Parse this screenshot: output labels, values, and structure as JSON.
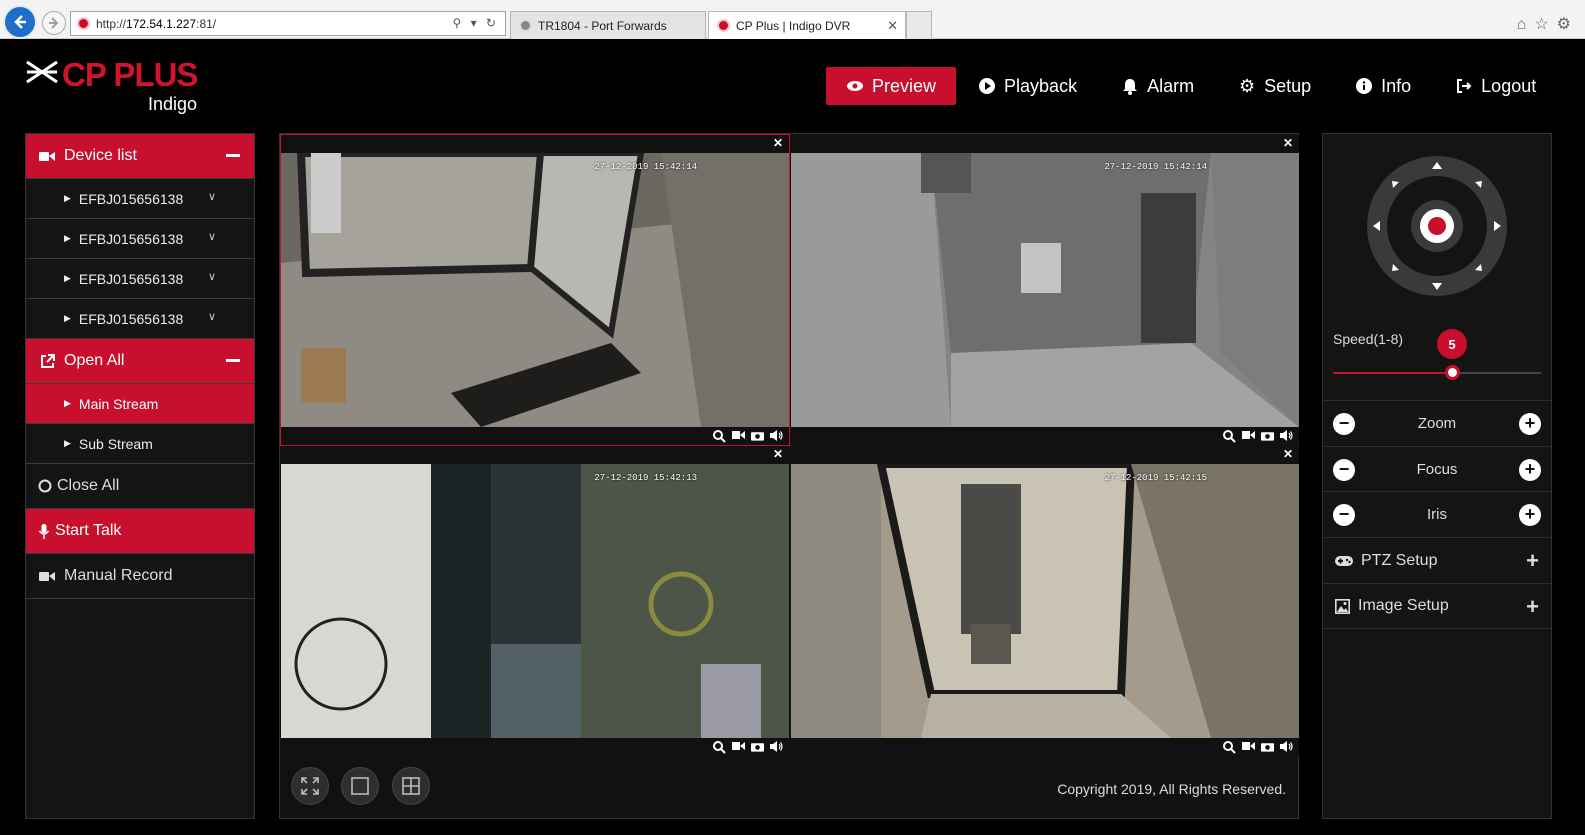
{
  "browser": {
    "url_prefix": "http://",
    "url_host": "172.54.1.227",
    "url_suffix": ":81/",
    "tabs": [
      {
        "title": "TR1804 - Port Forwards"
      },
      {
        "title": "CP Plus | Indigo DVR"
      }
    ]
  },
  "header": {
    "brand": "CP PLUS",
    "subbrand": "Indigo",
    "nav": [
      {
        "label": "Preview",
        "icon": "eye-icon",
        "active": true
      },
      {
        "label": "Playback",
        "icon": "play-circle-icon"
      },
      {
        "label": "Alarm",
        "icon": "bell-icon"
      },
      {
        "label": "Setup",
        "icon": "gear-icon"
      },
      {
        "label": "Info",
        "icon": "info-icon"
      },
      {
        "label": "Logout",
        "icon": "logout-icon"
      }
    ]
  },
  "sidebar": {
    "device_list_label": "Device list",
    "devices": [
      "EFBJ015656138",
      "EFBJ015656138",
      "EFBJ015656138",
      "EFBJ015656138"
    ],
    "open_all_label": "Open All",
    "streams": [
      "Main Stream",
      "Sub Stream"
    ],
    "close_all_label": "Close All",
    "start_talk_label": "Start Talk",
    "manual_record_label": "Manual Record"
  },
  "cameras": [
    {
      "timestamp": "27-12-2019 15:42:14"
    },
    {
      "timestamp": "27-12-2019 15:42:14"
    },
    {
      "timestamp": "27-12-2019 15:42:13"
    },
    {
      "timestamp": "27-12-2019 15:42:15"
    }
  ],
  "footer": {
    "copyright": "Copyright 2019, All Rights Reserved."
  },
  "ptz": {
    "speed_label": "Speed(1-8)",
    "speed_value": "5",
    "speed_fraction": 0.57,
    "rows": [
      "Zoom",
      "Focus",
      "Iris"
    ],
    "ptz_setup_label": "PTZ Setup",
    "image_setup_label": "Image Setup"
  },
  "colors": {
    "accent": "#c8102e"
  }
}
